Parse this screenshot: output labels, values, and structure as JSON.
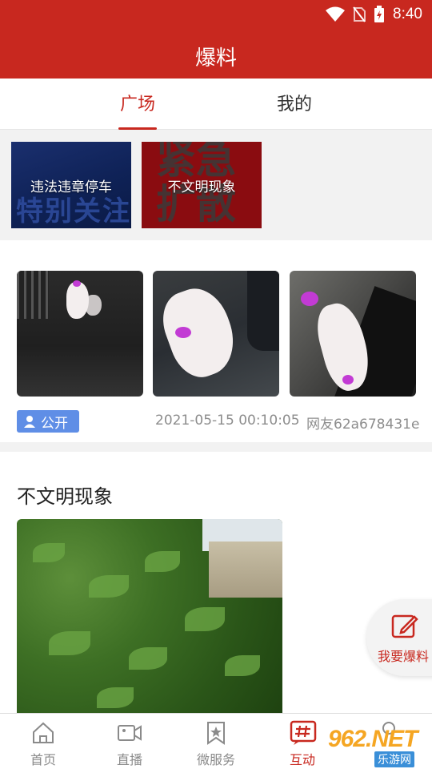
{
  "status_bar": {
    "time": "8:40"
  },
  "header": {
    "title": "爆料"
  },
  "tabs": [
    {
      "label": "广场",
      "active": true
    },
    {
      "label": "我的",
      "active": false
    }
  ],
  "categories": [
    {
      "label": "违法违章停车",
      "bg_text": "特别关注"
    },
    {
      "label": "不文明现象",
      "bg_text": "紧急扩散"
    }
  ],
  "post1": {
    "badge": "公开",
    "time": "2021-05-15 00:10:05",
    "user": "网友62a678431e"
  },
  "post2": {
    "title": "不文明现象"
  },
  "fab": {
    "label": "我要爆料"
  },
  "bottom_nav": [
    {
      "label": "首页",
      "icon": "home-icon",
      "active": false
    },
    {
      "label": "直播",
      "icon": "video-icon",
      "active": false
    },
    {
      "label": "微服务",
      "icon": "bookmark-star-icon",
      "active": false
    },
    {
      "label": "互动",
      "icon": "hashtag-icon",
      "active": true
    },
    {
      "label": "",
      "icon": "profile-icon",
      "active": false
    }
  ],
  "watermark": {
    "text": "962.NET",
    "sub": "乐游网"
  },
  "colors": {
    "brand": "#c8281f",
    "badge": "#5f8ee6",
    "meta": "#8d8d8d"
  }
}
